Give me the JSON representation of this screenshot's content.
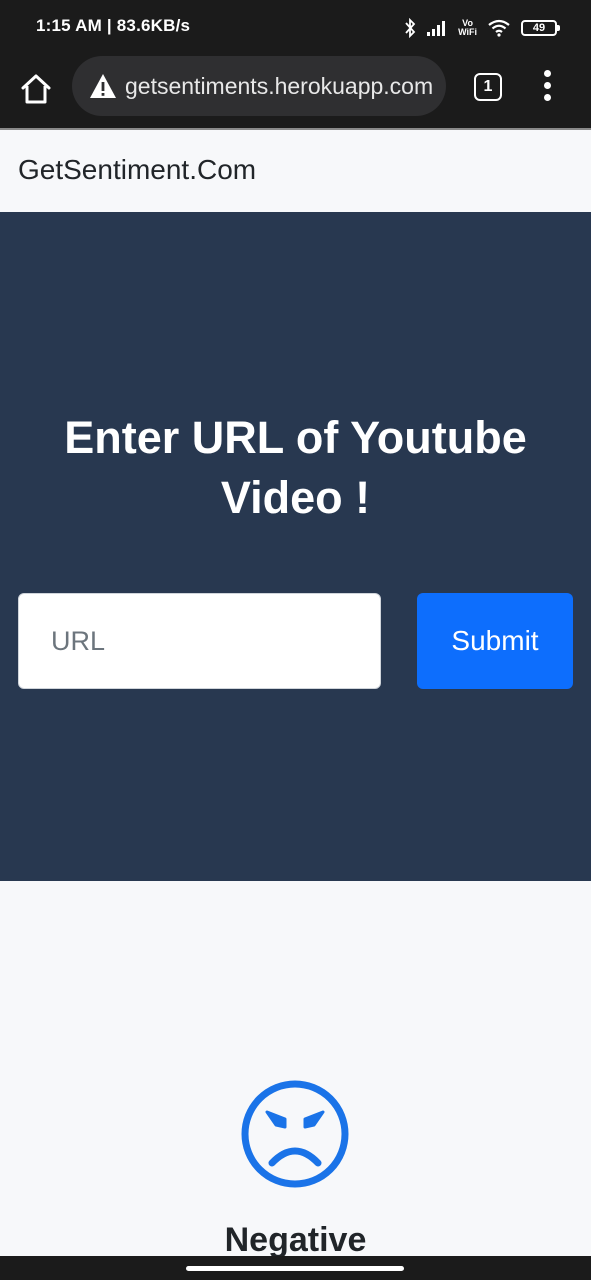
{
  "status_bar": {
    "time_speed": "1:15 AM | 83.6KB/s",
    "network_label": "Vo\nWiFi",
    "battery": "49",
    "icons": [
      "bluetooth-icon",
      "signal-icon",
      "wifi-icon",
      "battery-icon"
    ]
  },
  "browser": {
    "url": "getsentiments.herokuapp.com",
    "tab_count": "1",
    "icons": [
      "home-icon",
      "warning-icon",
      "tabs-icon",
      "menu-icon"
    ]
  },
  "navbar": {
    "brand": "GetSentiment.Com"
  },
  "hero": {
    "title": "Enter URL of Youtube Video !",
    "url_placeholder": "URL",
    "url_value": "",
    "submit_label": "Submit"
  },
  "result": {
    "icon": "angry-face-icon",
    "label": "Negative"
  },
  "colors": {
    "hero_bg": "#283850",
    "accent": "#0d6efd",
    "page_bg": "#f7f8fa",
    "chrome_bg": "#1b1b1b"
  }
}
